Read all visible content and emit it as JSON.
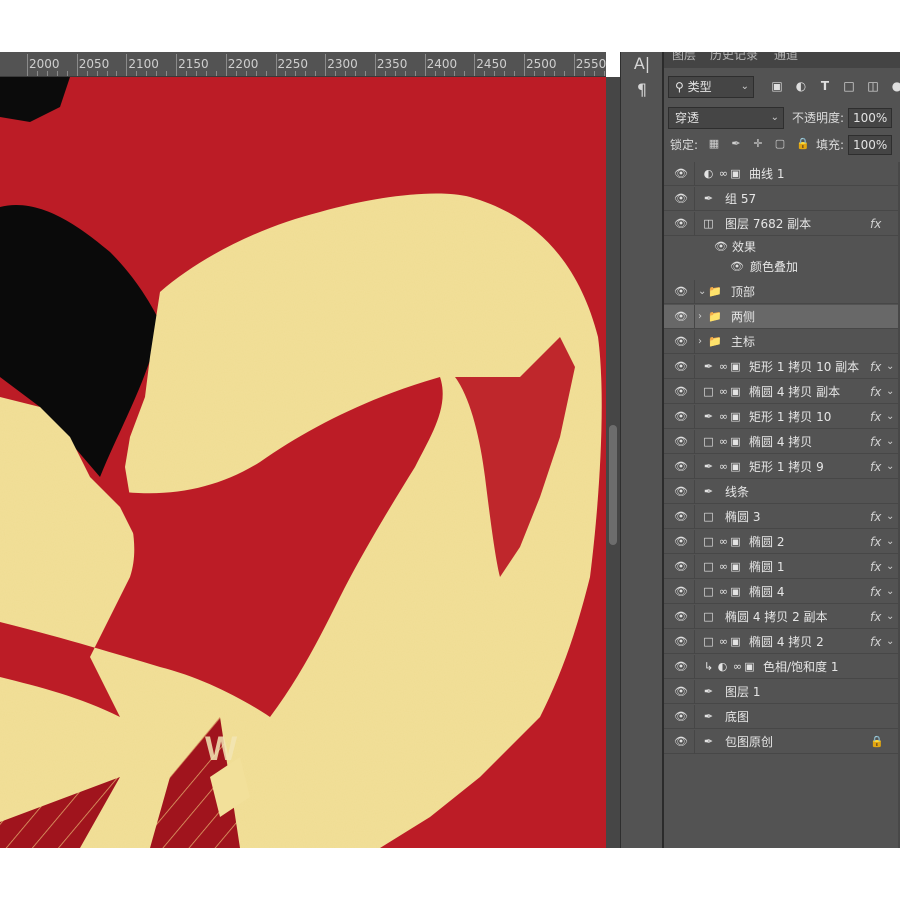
{
  "ruler": {
    "labels": [
      "2000",
      "2050",
      "2100",
      "2150",
      "2200",
      "2250",
      "2300",
      "2350",
      "2400",
      "2450",
      "2500",
      "2550"
    ]
  },
  "toolstrip": {
    "character_glyph": "A|",
    "paragraph_glyph": "¶"
  },
  "panel": {
    "tabs": [
      "图层",
      "历史记录",
      "通道"
    ],
    "filter": {
      "kind": "类型",
      "search_icon": "search-icon"
    },
    "blend_mode": "穿透",
    "opacity_label": "不透明度:",
    "opacity_value": "100%",
    "lock_label": "锁定:",
    "fill_label": "填充:",
    "fill_value": "100%"
  },
  "layers": [
    {
      "name": "曲线 1",
      "type": "adjustment-curves"
    },
    {
      "name": "组 57",
      "type": "brush"
    },
    {
      "name": "图层 7682 副本",
      "type": "smart-object",
      "fx": true
    },
    {
      "name": "顶部",
      "type": "folder-open"
    },
    {
      "name": "两侧",
      "type": "folder",
      "selected": true
    },
    {
      "name": "主标",
      "type": "folder"
    },
    {
      "name": "矩形 1 拷贝 10 副本",
      "type": "brush-masked",
      "fx": true
    },
    {
      "name": "椭圆 4 拷贝 副本",
      "type": "shape-masked",
      "fx": true
    },
    {
      "name": "矩形 1 拷贝 10",
      "type": "brush-masked",
      "fx": true
    },
    {
      "name": "椭圆 4 拷贝",
      "type": "shape-masked",
      "fx": true
    },
    {
      "name": "矩形 1 拷贝 9",
      "type": "brush-masked",
      "fx": true
    },
    {
      "name": "线条",
      "type": "brush"
    },
    {
      "name": "椭圆 3",
      "type": "shape",
      "fx": true
    },
    {
      "name": "椭圆 2",
      "type": "shape-masked",
      "fx": true
    },
    {
      "name": "椭圆 1",
      "type": "shape-masked",
      "fx": true
    },
    {
      "name": "椭圆 4",
      "type": "shape-masked",
      "fx": true
    },
    {
      "name": "椭圆 4 拷贝 2 副本",
      "type": "shape",
      "fx": true
    },
    {
      "name": "椭圆 4 拷贝 2",
      "type": "shape-masked",
      "fx": true
    },
    {
      "name": "色相/饱和度 1",
      "type": "adjustment-hue"
    },
    {
      "name": "图层 1",
      "type": "brush"
    },
    {
      "name": "底图",
      "type": "brush"
    },
    {
      "name": "包图原创",
      "type": "brush",
      "locked": true
    }
  ],
  "effects": {
    "label": "效果",
    "items": [
      "颜色叠加"
    ]
  },
  "fx_label": "fx",
  "canvas": {
    "text_fragment": "W"
  },
  "colors": {
    "canvas_red": "#bc1c26",
    "gold": "#f2e09a",
    "panel_bg": "#535353"
  }
}
